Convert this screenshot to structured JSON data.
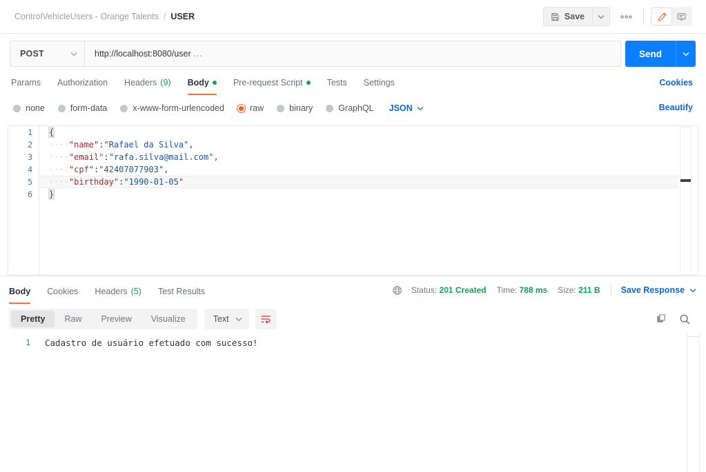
{
  "topbar": {
    "breadcrumb_collection": "ControlVehicleUsers - Orange Talents",
    "breadcrumb_separator": "/",
    "breadcrumb_current": "USER",
    "save_label": "Save",
    "more_label": "●●●",
    "edit_icon": "pencil-icon",
    "comment_icon": "comment-icon",
    "accent_color": "#ff6c37"
  },
  "request": {
    "method": "POST",
    "url": "http://localhost:8080/user",
    "url_ellipsis": "...",
    "send_label": "Send",
    "send_color": "#0b7fff",
    "tabs": [
      {
        "label": "Params",
        "count": "",
        "dot": false,
        "active": false
      },
      {
        "label": "Authorization",
        "count": "",
        "dot": false,
        "active": false
      },
      {
        "label": "Headers",
        "count": "(9)",
        "dot": false,
        "active": false
      },
      {
        "label": "Body",
        "count": "",
        "dot": true,
        "active": true
      },
      {
        "label": "Pre-request Script",
        "count": "",
        "dot": true,
        "active": false
      },
      {
        "label": "Tests",
        "count": "",
        "dot": false,
        "active": false
      },
      {
        "label": "Settings",
        "count": "",
        "dot": false,
        "active": false
      }
    ],
    "cookies_label": "Cookies",
    "beautify_label": "Beautify",
    "body_types": [
      {
        "label": "none",
        "selected": false
      },
      {
        "label": "form-data",
        "selected": false
      },
      {
        "label": "x-www-form-urlencoded",
        "selected": false
      },
      {
        "label": "raw",
        "selected": true
      },
      {
        "label": "binary",
        "selected": false
      },
      {
        "label": "GraphQL",
        "selected": false
      }
    ],
    "raw_format": "JSON",
    "body_lines": [
      {
        "num": "1",
        "text": "{"
      },
      {
        "num": "2",
        "key": "\"name\"",
        "value": "\"Rafael da Silva\"",
        "comma": ","
      },
      {
        "num": "3",
        "key": "\"email\"",
        "value": "\"rafa.silva@mail.com\"",
        "comma": ","
      },
      {
        "num": "4",
        "key": "\"cpf\"",
        "value": "\"42407077903\"",
        "comma": ","
      },
      {
        "num": "5",
        "key": "\"birthday\"",
        "value": "\"1990-01-05\"",
        "comma": ""
      },
      {
        "num": "6",
        "text": "}"
      }
    ]
  },
  "response": {
    "tabs": [
      {
        "label": "Body",
        "count": "",
        "active": true
      },
      {
        "label": "Cookies",
        "count": "",
        "active": false
      },
      {
        "label": "Headers",
        "count": "(5)",
        "active": false
      },
      {
        "label": "Test Results",
        "count": "",
        "active": false
      }
    ],
    "status_label": "Status:",
    "status_value": "201 Created",
    "time_label": "Time:",
    "time_value": "788 ms",
    "size_label": "Size:",
    "size_value": "211 B",
    "save_response_label": "Save Response",
    "status_color": "#12a150",
    "view_modes": [
      {
        "label": "Pretty",
        "active": true
      },
      {
        "label": "Raw",
        "active": false
      },
      {
        "label": "Preview",
        "active": false
      },
      {
        "label": "Visualize",
        "active": false
      }
    ],
    "format": "Text",
    "wrap_icon": "wrap-lines-icon",
    "copy_icon": "copy-icon",
    "search_icon": "search-icon",
    "globe_icon": "globe-icon",
    "body_line_number": "1",
    "body_text": "Cadastro de usuário efetuado com sucesso!"
  }
}
